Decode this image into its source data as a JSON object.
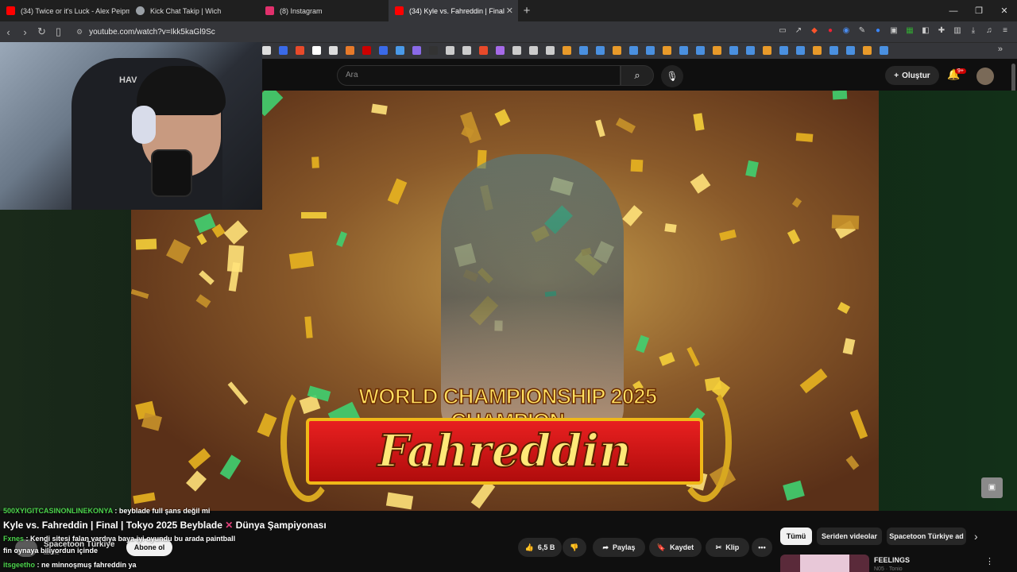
{
  "browser": {
    "tabs": [
      {
        "label": "(34) Twice or it's Luck - Alex Peipman",
        "icon": "youtube-icon",
        "color": "#ff0000"
      },
      {
        "label": "Kick Chat Takip | Wich",
        "icon": "globe-icon",
        "color": "#9aa0a6"
      },
      {
        "label": "(8) Instagram",
        "icon": "instagram-icon",
        "color": "#e1306c"
      },
      {
        "label": "(34) Kyle vs. Fahreddin | Final",
        "icon": "youtube-icon",
        "color": "#ff0000"
      }
    ],
    "url": "youtube.com/watch?v=Ikk5kaGl9Sc"
  },
  "youtube": {
    "search_placeholder": "Ara",
    "create_label": "Oluştur",
    "notif_count": "9+"
  },
  "video": {
    "banner_top": "WORLD CHAMPIONSHIP 2025 CHAMPION",
    "banner_name": "Fahreddin",
    "title_pre": "Kyle vs. Fahreddin | Final | Tokyo 2025 Beyblade",
    "title_post": "Dünya Şampiyonası",
    "channel": "Spacetoon Türkiye",
    "subscribers": "abone",
    "subscribe_label": "Abone ol",
    "likes": "6,5 B",
    "share_label": "Paylaş",
    "save_label": "Kaydet",
    "clip_label": "Klip"
  },
  "chat": [
    {
      "user": "500XYIGITCASINONLINEKONYA",
      "msg": " : beyblade full şans değil mi"
    },
    {
      "user": "Fxnes",
      "msg": " : Kendi sitesi falan vardıya baya iyi oyundu bu arada paintball"
    },
    {
      "user": "fin",
      "msg": " oynaya biliyordun içinde"
    },
    {
      "user": "itsgeetho",
      "msg": " : ne minnoşmuş fahreddin ya"
    }
  ],
  "recommendations": {
    "chips": [
      "Tümü",
      "Seriden videolar",
      "Spacetoon Türkiye ad"
    ],
    "first_title": "FEELINGS",
    "first_sub": "N05 · Tonio"
  },
  "webcam": {
    "logo": "HAV"
  }
}
